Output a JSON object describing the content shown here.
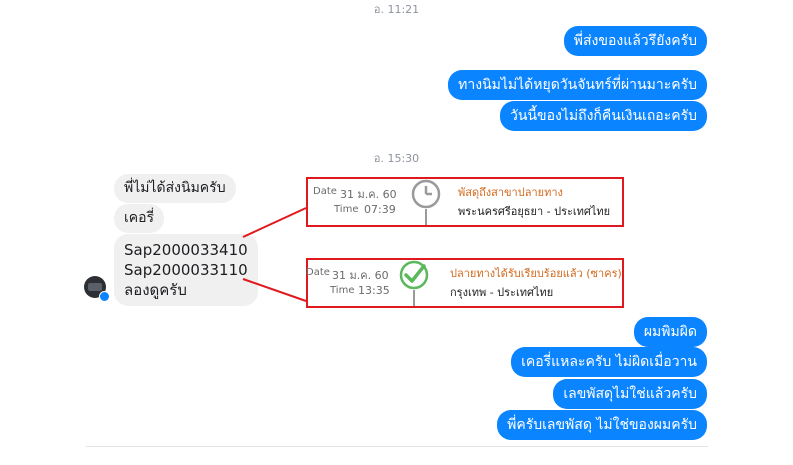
{
  "timestamps": [
    "อ. 11:21",
    "อ. 15:30"
  ],
  "outgoing_top": [
    "พี่ส่งของแล้วรึยังครับ",
    "ทางนิมไม่ได้หยุดวันจันทร์ที่ผ่านมาะครับ",
    "วันนี้ของไม่ถึงก็คืนเงินเถอะครับ"
  ],
  "incoming": [
    "พี่ไม่ได้ส่งนิมครับ",
    "เคอรี่",
    "Sap2000033410\nSap2000033110\nลองดูครับ"
  ],
  "tracking": [
    {
      "date_label": "Date",
      "date": "31 ม.ค. 60",
      "time_label": "Time",
      "time": "07:39",
      "status": "พัสดุถึงสาขาปลายทาง",
      "location": "พระนครศรีอยุธยา - ประเทศไทย",
      "icon": "clock-icon"
    },
    {
      "date_label": "Date",
      "date": "31 ม.ค. 60",
      "time_label": "Time",
      "time": "13:35",
      "status": "ปลายทางได้รับเรียบร้อยแล้ว (ซาคร)",
      "location": "กรุงเทพ - ประเทศไทย",
      "icon": "check-circle-icon"
    }
  ],
  "outgoing_bottom": [
    "ผมพิมผิด",
    "เคอรี่แหละครับ ไม่ผิดเมื่อวาน",
    "เลขพัสดุไม่ใช่แล้วครับ",
    "พี่ครับเลขพัสดุ ไม่ใช่ของผมครับ"
  ],
  "colors": {
    "outgoing_bubble": "#0b84ff",
    "incoming_bubble": "#f1f0f0",
    "highlight": "#e0191f",
    "status_text": "#d2691e",
    "check_green": "#5cb85c"
  }
}
